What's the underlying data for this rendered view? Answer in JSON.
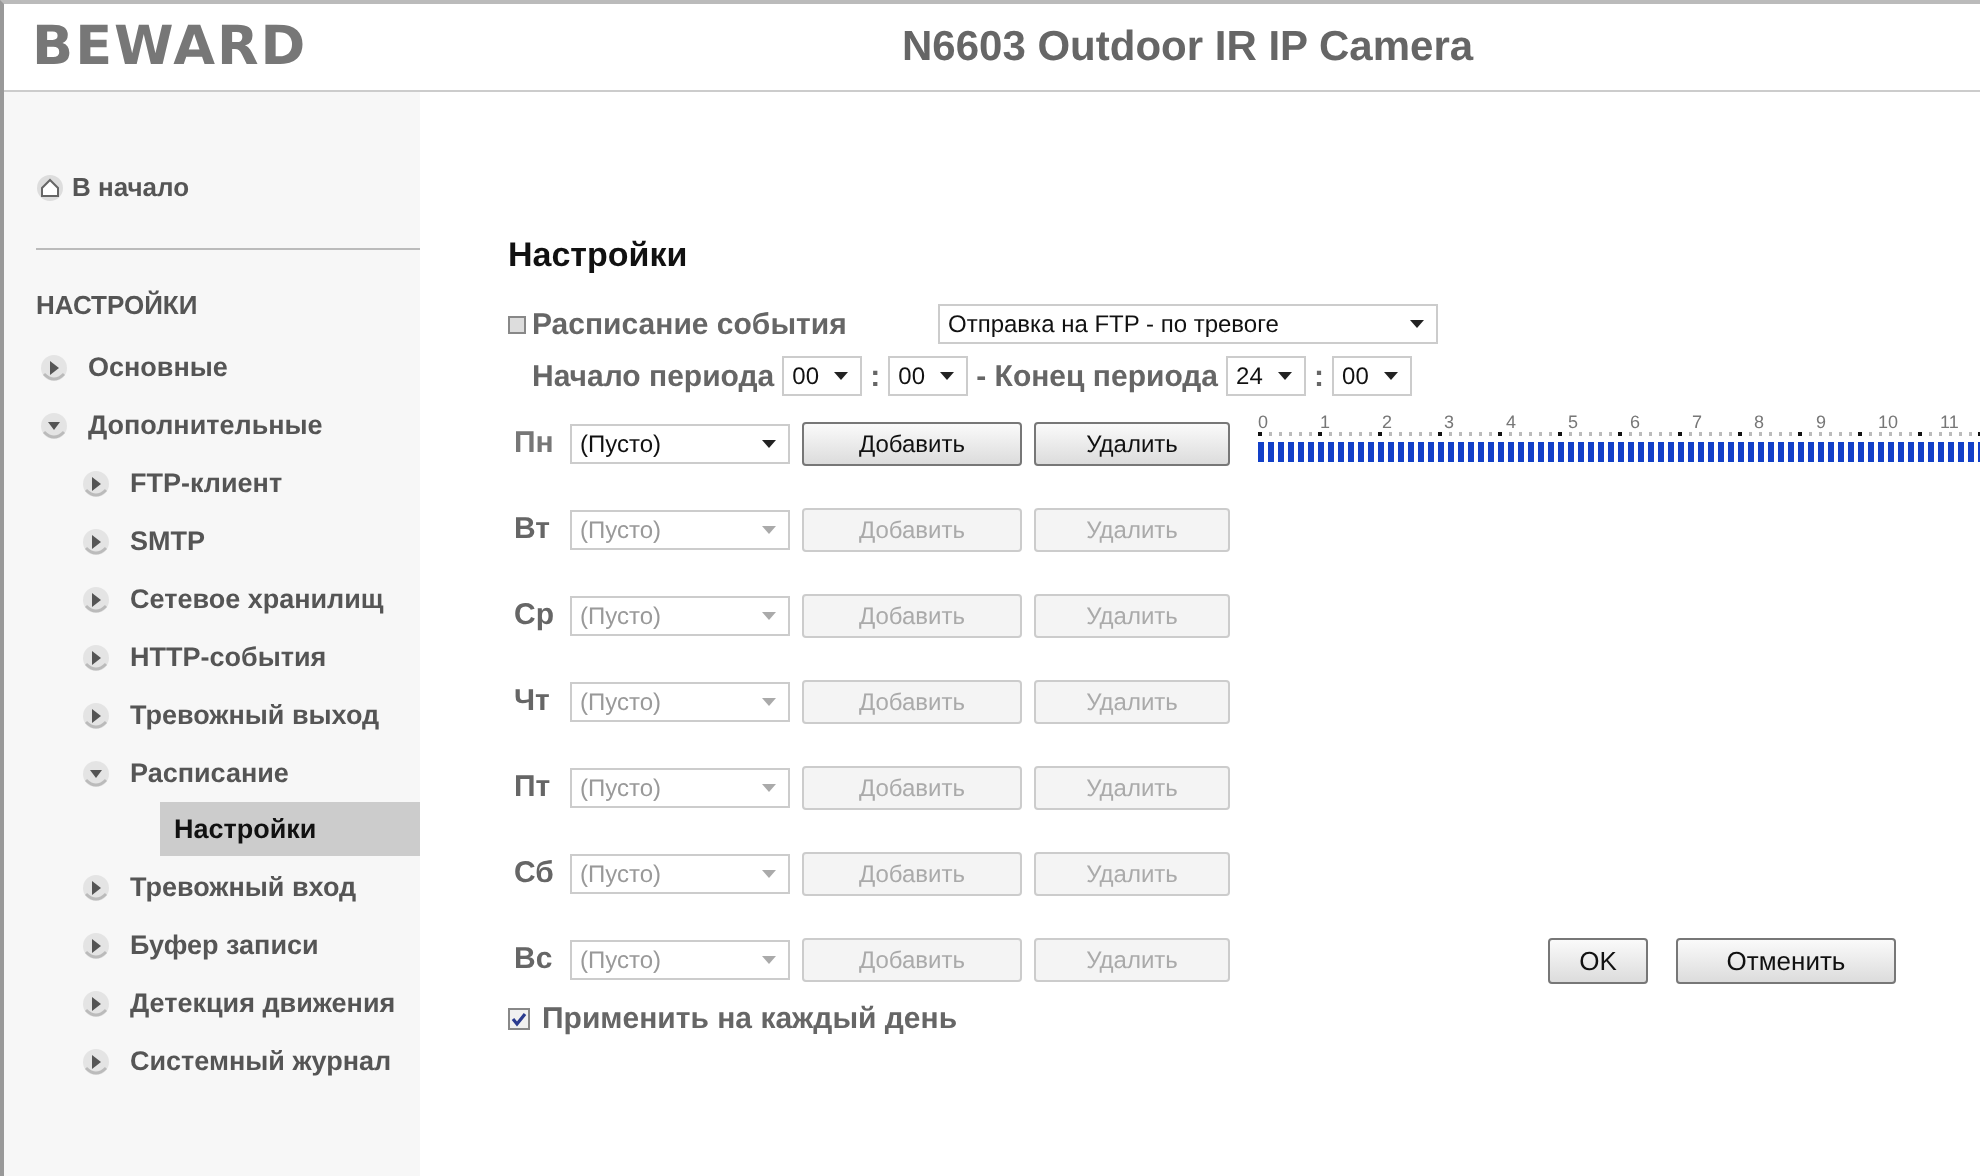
{
  "header": {
    "logo": "BEWARD",
    "title": "N6603 Outdoor IR IP Camera"
  },
  "sidebar": {
    "home": "В начало",
    "section": "НАСТРОЙКИ",
    "items": [
      {
        "label": "Основные",
        "expanded": false,
        "selected": false
      },
      {
        "label": "Дополнительные",
        "expanded": true,
        "selected": false,
        "children": [
          {
            "label": "FTP-клиент",
            "expanded": false,
            "selected": false
          },
          {
            "label": "SMTP",
            "expanded": false,
            "selected": false
          },
          {
            "label": "Сетевое хранилищ",
            "expanded": false,
            "selected": false
          },
          {
            "label": "HTTP-события",
            "expanded": false,
            "selected": false
          },
          {
            "label": "Тревожный выход",
            "expanded": false,
            "selected": false
          },
          {
            "label": "Расписание",
            "expanded": true,
            "selected": false,
            "children": [
              {
                "label": "Настройки",
                "selected": true
              }
            ]
          },
          {
            "label": "Тревожный вход",
            "expanded": false,
            "selected": false
          },
          {
            "label": "Буфер записи",
            "expanded": false,
            "selected": false
          },
          {
            "label": "Детекция движения",
            "expanded": false,
            "selected": false
          },
          {
            "label": "Системный журнал",
            "expanded": false,
            "selected": false
          }
        ]
      }
    ]
  },
  "main": {
    "heading": "Настройки",
    "event": {
      "label": "Расписание события",
      "value": "Отправка на FTP - по тревоге"
    },
    "period": {
      "start_label": "Начало периода",
      "start_hour": "00",
      "separator_1": ":",
      "start_minute": "00",
      "end_label": "- Конец периода",
      "end_hour": "24",
      "separator_2": ":",
      "end_minute": "00"
    },
    "timeline_hours": [
      "0",
      "1",
      "2",
      "3",
      "4",
      "5",
      "6",
      "7",
      "8",
      "9",
      "10",
      "11"
    ],
    "days": [
      {
        "label": "Пн",
        "value": "(Пусто)",
        "add": "Добавить",
        "remove": "Удалить",
        "disabled": false
      },
      {
        "label": "Вт",
        "value": "(Пусто)",
        "add": "Добавить",
        "remove": "Удалить",
        "disabled": true
      },
      {
        "label": "Ср",
        "value": "(Пусто)",
        "add": "Добавить",
        "remove": "Удалить",
        "disabled": true
      },
      {
        "label": "Чт",
        "value": "(Пусто)",
        "add": "Добавить",
        "remove": "Удалить",
        "disabled": true
      },
      {
        "label": "Пт",
        "value": "(Пусто)",
        "add": "Добавить",
        "remove": "Удалить",
        "disabled": true
      },
      {
        "label": "Сб",
        "value": "(Пусто)",
        "add": "Добавить",
        "remove": "Удалить",
        "disabled": true
      },
      {
        "label": "Вс",
        "value": "(Пусто)",
        "add": "Добавить",
        "remove": "Удалить",
        "disabled": true
      }
    ],
    "apply_every_day": {
      "label": "Применить на каждый день",
      "checked": true
    },
    "buttons": [
      "OK",
      "Отменить"
    ]
  }
}
